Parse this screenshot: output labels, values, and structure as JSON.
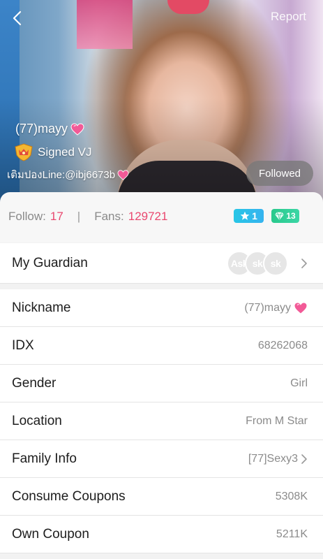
{
  "header": {
    "back_icon": "chevron-left-icon",
    "report_label": "Report"
  },
  "profile": {
    "display_name": "(77)mayy",
    "name_heart_icon": "pink-heart-icon",
    "signed_badge_icon": "crown-shield-icon",
    "signed_label": "Signed VJ",
    "line_text": "เติมปองLine:@ibj6673b",
    "follow_button_label": "Followed"
  },
  "stats": {
    "follow_label": "Follow:",
    "follow_count": "17",
    "separator": "|",
    "fans_label": "Fans:",
    "fans_count": "129721",
    "level_badge": "1",
    "gem_badge": "13"
  },
  "guardian": {
    "label": "My Guardian",
    "avatars": [
      "Ask",
      "sk",
      "sk"
    ]
  },
  "rows": [
    {
      "label": "Nickname",
      "value": "(77)mayy"
    },
    {
      "label": "IDX",
      "value": "68262068"
    },
    {
      "label": "Gender",
      "value": "Girl"
    },
    {
      "label": "Location",
      "value": "From M Star"
    },
    {
      "label": "Family Info",
      "value": "[77]Sexy3"
    },
    {
      "label": "Consume Coupons",
      "value": "5308K"
    },
    {
      "label": "Own Coupon",
      "value": "5211K"
    }
  ],
  "colors": {
    "accent_pink": "#e9486f",
    "level_badge": "#2fbfe9",
    "gem_badge": "#2fcf97",
    "followed_button": "#787878"
  }
}
